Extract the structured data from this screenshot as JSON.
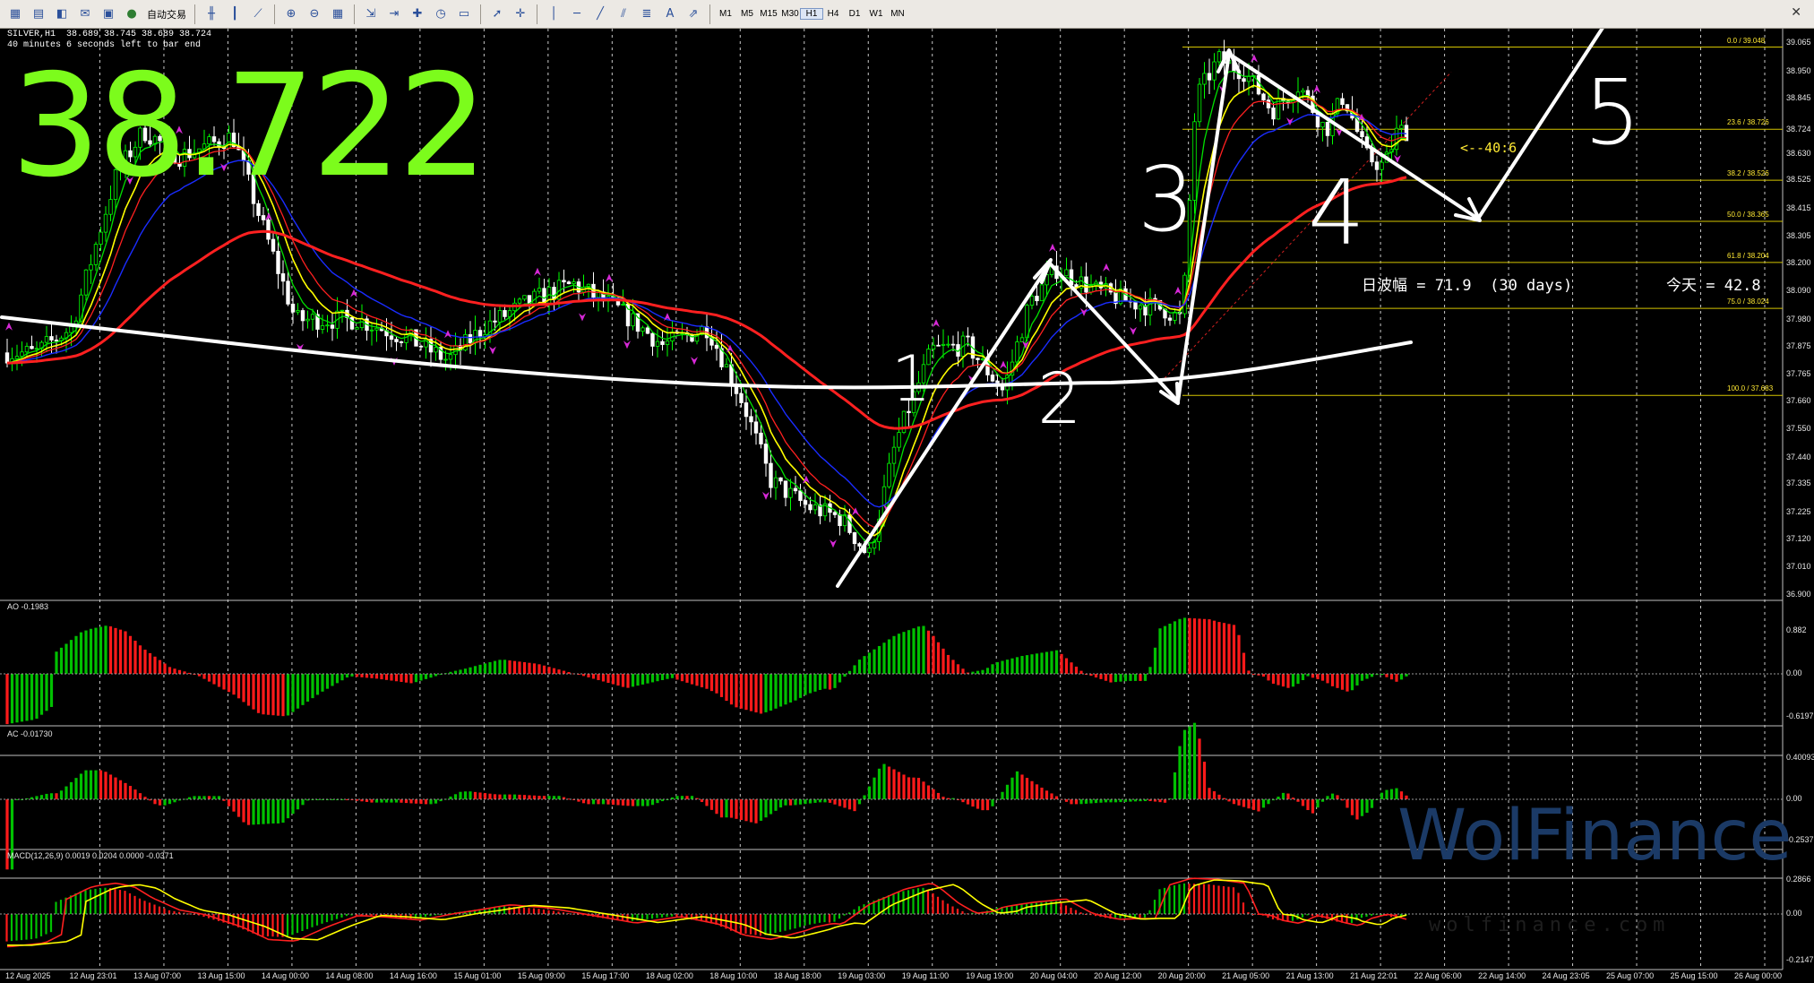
{
  "toolbar": {
    "auto_trading_label": "自动交易",
    "timeframes": [
      "M1",
      "M5",
      "M15",
      "M30",
      "H1",
      "H4",
      "D1",
      "W1",
      "MN"
    ],
    "active_timeframe": "H1"
  },
  "chart_header": {
    "symbol_line": "SILVER,H1  38.689 38.745 38.689 38.724",
    "countdown": "40 minutes 6 seconds left to bar end"
  },
  "big_price": "38.722",
  "wave_stat": {
    "daily_range": "日波幅 = 71.9  (30 days)",
    "today": "今天 = 42.8"
  },
  "countdown_label": "<--40:6",
  "wave_labels": [
    "1",
    "2",
    "3",
    "4",
    "5"
  ],
  "fib_levels": [
    {
      "label": "0.0 / 39.048"
    },
    {
      "label": "23.6 / 38.726"
    },
    {
      "label": "38.2 / 38.526"
    },
    {
      "label": "50.0 / 38.365"
    },
    {
      "label": "61.8 / 38.204"
    },
    {
      "label": "75.0 / 38.024"
    },
    {
      "label": "100.0 / 37.683"
    }
  ],
  "price_axis": [
    "39.065",
    "38.950",
    "38.845",
    "38.724",
    "38.630",
    "38.525",
    "38.415",
    "38.305",
    "38.200",
    "38.090",
    "37.980",
    "37.875",
    "37.765",
    "37.660",
    "37.550",
    "37.440",
    "37.335",
    "37.225",
    "37.120",
    "37.010",
    "36.900"
  ],
  "time_axis": [
    "12 Aug 2025",
    "12 Aug 23:01",
    "13 Aug 07:00",
    "13 Aug 15:00",
    "14 Aug 00:00",
    "14 Aug 08:00",
    "14 Aug 16:00",
    "15 Aug 01:00",
    "15 Aug 09:00",
    "15 Aug 17:00",
    "18 Aug 02:00",
    "18 Aug 10:00",
    "18 Aug 18:00",
    "19 Aug 03:00",
    "19 Aug 11:00",
    "19 Aug 19:00",
    "20 Aug 04:00",
    "20 Aug 12:00",
    "20 Aug 20:00",
    "21 Aug 05:00",
    "21 Aug 13:00",
    "21 Aug 22:01",
    "22 Aug 06:00",
    "22 Aug 14:00",
    "24 Aug 23:05",
    "25 Aug 07:00",
    "25 Aug 15:00",
    "26 Aug 00:00"
  ],
  "indicators": {
    "ao": {
      "label": "AO -0.1983",
      "scale": [
        "0.882",
        "0.00",
        "-0.6197"
      ]
    },
    "ac": {
      "label": "AC -0.01730",
      "scale": [
        "0.40093",
        "0.00",
        "-0.2537"
      ]
    },
    "macd": {
      "label": "MACD(12,26,9) 0.0019 0.0204 0.0000 -0.0371",
      "scale": [
        "0.2866",
        "0.00",
        "-0.2147"
      ]
    }
  },
  "watermark": {
    "brand": "WolFinance",
    "url": "wolfinance.com"
  },
  "colors": {
    "background": "#000000",
    "bull_candle": "#00ff00",
    "bear_candle": "#ffffff",
    "ma_red": "#ff2020",
    "ma_yellow": "#ffff00",
    "ma_green": "#00e000",
    "ma_blue": "#1a2cff",
    "fib": "#ffe933",
    "annotation": "#ffffff",
    "big_price": "#7cfc1c"
  }
}
